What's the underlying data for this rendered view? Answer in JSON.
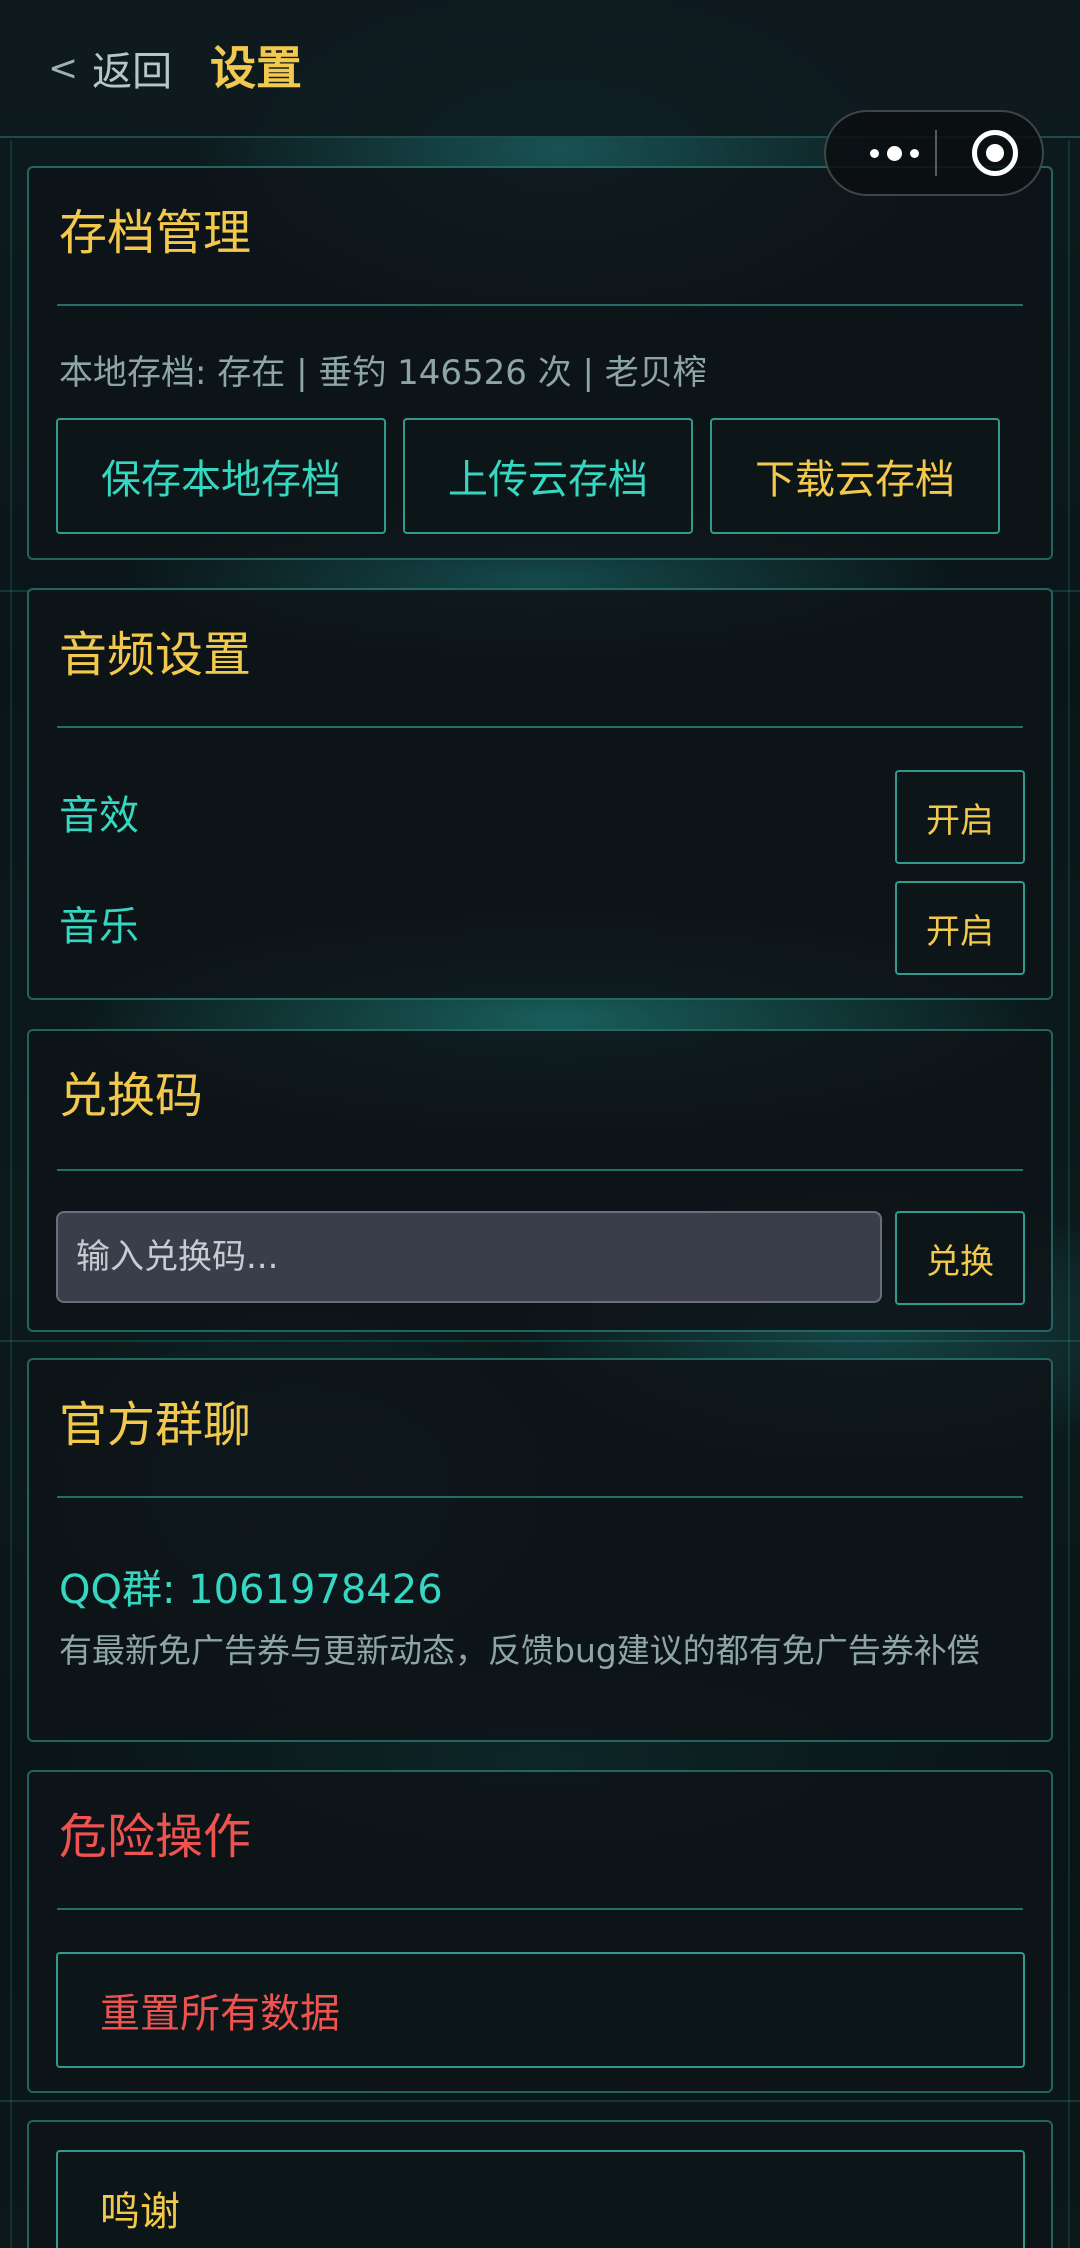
{
  "header": {
    "back_label": "返回",
    "title": "设置"
  },
  "capsule": {
    "more_icon": "more-dots-icon",
    "close_icon": "target-close-icon"
  },
  "archive": {
    "title": "存档管理",
    "status": "本地存档: 存在 | 垂钓 146526 次 | 老贝榨",
    "save_local": "保存本地存档",
    "upload_cloud": "上传云存档",
    "download_cloud": "下载云存档"
  },
  "audio": {
    "title": "音频设置",
    "sfx_label": "音效",
    "sfx_toggle": "开启",
    "music_label": "音乐",
    "music_toggle": "开启"
  },
  "redeem": {
    "title": "兑换码",
    "placeholder": "输入兑换码...",
    "button": "兑换"
  },
  "group": {
    "title": "官方群聊",
    "qq": "QQ群: 1061978426",
    "description": "有最新免广告券与更新动态，反馈bug建议的都有免广告券补偿"
  },
  "danger": {
    "title": "危险操作",
    "reset_button": "重置所有数据"
  },
  "credits": {
    "button": "鸣谢"
  },
  "colors": {
    "accent_gold": "#f2c94c",
    "accent_teal": "#37d6c0",
    "danger_red": "#ef5350",
    "border_teal": "#3cc8b4"
  }
}
